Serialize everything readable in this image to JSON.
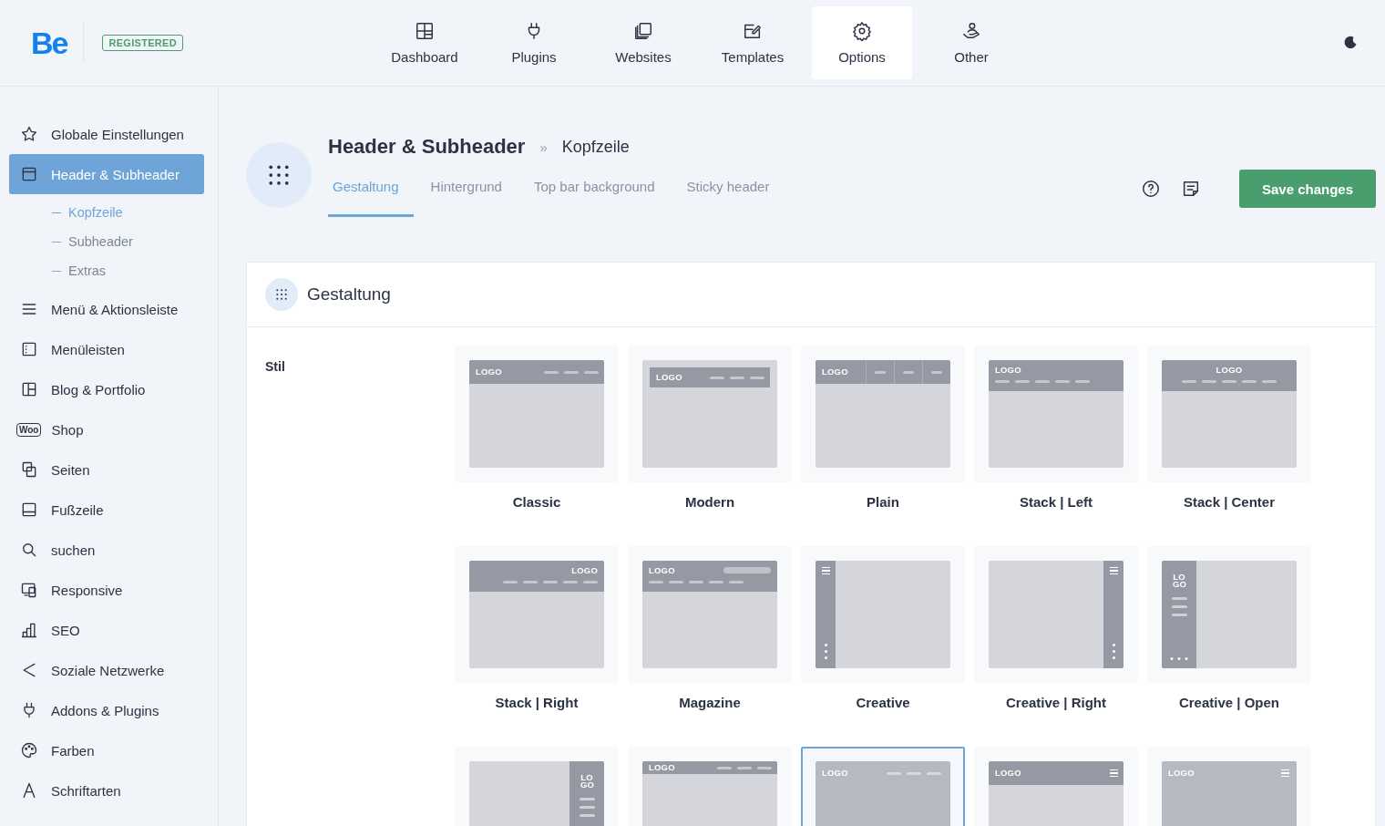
{
  "brand": {
    "logo": "Be",
    "badge": "REGISTERED"
  },
  "nav": [
    {
      "label": "Dashboard",
      "kind": "dashboard",
      "selected": false
    },
    {
      "label": "Plugins",
      "kind": "plug",
      "selected": false
    },
    {
      "label": "Websites",
      "kind": "copies",
      "selected": false
    },
    {
      "label": "Templates",
      "kind": "edit",
      "selected": false
    },
    {
      "label": "Options",
      "kind": "gear",
      "selected": true
    },
    {
      "label": "Other",
      "kind": "person",
      "selected": false
    }
  ],
  "sidebar": {
    "items": [
      {
        "label": "Globale Einstellungen",
        "kind": "star",
        "selected": false
      },
      {
        "label": "Header & Subheader",
        "kind": "window",
        "selected": true,
        "children": [
          {
            "label": "Kopfzeile",
            "selected": true
          },
          {
            "label": "Subheader",
            "selected": false
          },
          {
            "label": "Extras",
            "selected": false
          }
        ]
      },
      {
        "label": "Menü & Aktionsleiste",
        "kind": "menu",
        "selected": false
      },
      {
        "label": "Menüleisten",
        "kind": "listpanel",
        "selected": false
      },
      {
        "label": "Blog & Portfolio",
        "kind": "columns",
        "selected": false
      },
      {
        "label": "Shop",
        "kind": "woo",
        "icon_text": "Woo",
        "selected": false
      },
      {
        "label": "Seiten",
        "kind": "pages",
        "selected": false
      },
      {
        "label": "Fußzeile",
        "kind": "footer",
        "selected": false
      },
      {
        "label": "suchen",
        "kind": "search",
        "selected": false
      },
      {
        "label": "Responsive",
        "kind": "responsive",
        "selected": false
      },
      {
        "label": "SEO",
        "kind": "chart",
        "selected": false
      },
      {
        "label": "Soziale Netzwerke",
        "kind": "share",
        "selected": false
      },
      {
        "label": "Addons & Plugins",
        "kind": "plug",
        "selected": false
      },
      {
        "label": "Farben",
        "kind": "palette",
        "selected": false
      },
      {
        "label": "Schriftarten",
        "kind": "font",
        "selected": false
      }
    ]
  },
  "page": {
    "title": "Header & Subheader",
    "separator": "»",
    "subtitle": "Kopfzeile",
    "tabs": [
      {
        "label": "Gestaltung",
        "selected": true
      },
      {
        "label": "Hintergrund",
        "selected": false
      },
      {
        "label": "Top bar background",
        "selected": false
      },
      {
        "label": "Sticky header",
        "selected": false
      }
    ],
    "save_button": "Save changes"
  },
  "panel": {
    "title": "Gestaltung",
    "field_label": "Stil",
    "styles": [
      {
        "label": "Classic",
        "kind": "classic",
        "logo": "LOGO",
        "selected": false
      },
      {
        "label": "Modern",
        "kind": "modern",
        "logo": "LOGO",
        "selected": false
      },
      {
        "label": "Plain",
        "kind": "plain",
        "logo": "LOGO",
        "selected": false
      },
      {
        "label": "Stack | Left",
        "kind": "stack-left",
        "logo": "LOGO",
        "selected": false
      },
      {
        "label": "Stack | Center",
        "kind": "stack-center",
        "logo": "LOGO",
        "selected": false
      },
      {
        "label": "Stack | Right",
        "kind": "stack-right",
        "logo": "LOGO",
        "selected": false
      },
      {
        "label": "Magazine",
        "kind": "magazine",
        "logo": "LOGO",
        "selected": false
      },
      {
        "label": "Creative",
        "kind": "creative",
        "selected": false
      },
      {
        "label": "Creative | Right",
        "kind": "creative-right",
        "selected": false
      },
      {
        "label": "Creative | Open",
        "kind": "creative-open",
        "logo": "LO GO",
        "selected": false
      },
      {
        "kind": "creative-open-right",
        "logo": "LO GO",
        "selected": false
      },
      {
        "kind": "fixed",
        "logo": "LOGO",
        "selected": false
      },
      {
        "kind": "transparent",
        "logo": "LOGO",
        "selected": true
      },
      {
        "kind": "simple",
        "logo": "LOGO",
        "selected": false
      },
      {
        "kind": "overlay",
        "logo": "LOGO",
        "selected": false
      }
    ]
  }
}
